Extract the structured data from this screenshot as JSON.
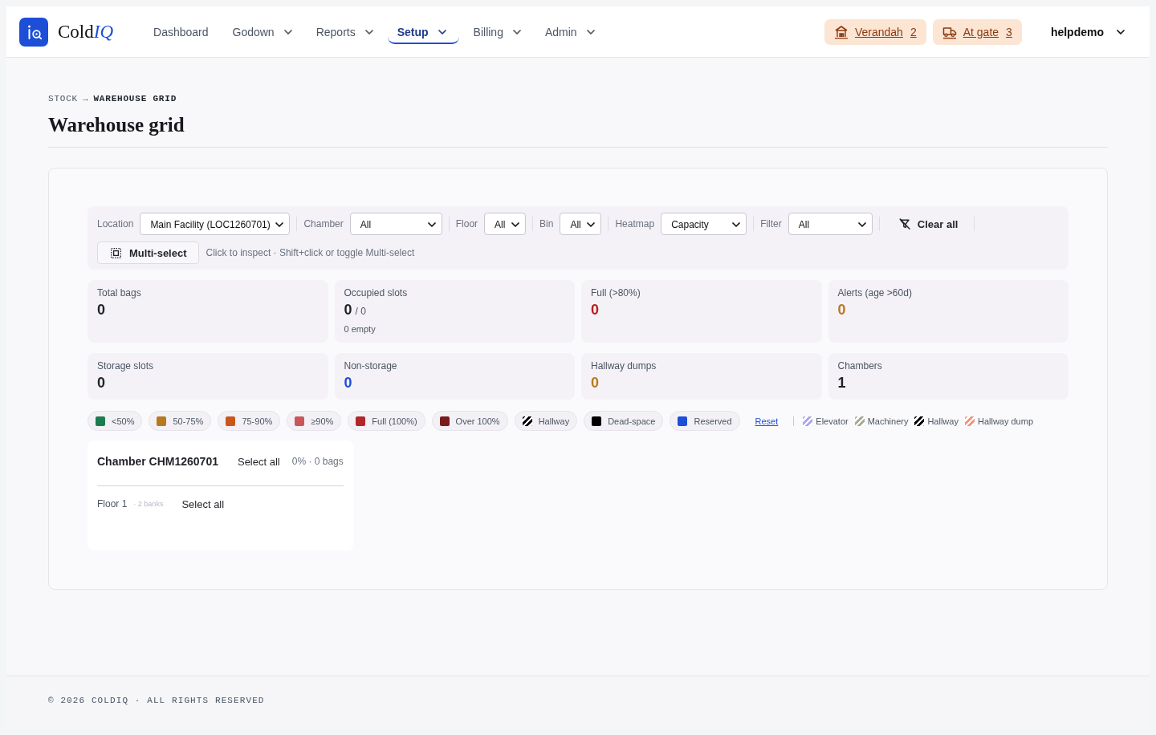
{
  "header": {
    "brand": {
      "main": "Cold",
      "accent": "IQ"
    },
    "nav": [
      {
        "label": "Dashboard",
        "selected": false,
        "dropdown": false
      },
      {
        "label": "Godown",
        "selected": false,
        "dropdown": true
      },
      {
        "label": "Reports",
        "selected": false,
        "dropdown": true
      },
      {
        "label": "Setup",
        "selected": true,
        "dropdown": true
      },
      {
        "label": "Billing",
        "selected": false,
        "dropdown": true
      },
      {
        "label": "Admin",
        "selected": false,
        "dropdown": true
      }
    ],
    "queues": [
      {
        "label": "Verandah",
        "count": "2",
        "kind": "shelter"
      },
      {
        "label": "At gate",
        "count": "3",
        "kind": "truck"
      }
    ],
    "user": "helpdemo"
  },
  "breadcrumb": {
    "items": [
      {
        "label": "STOCK",
        "current": false
      },
      {
        "label": "WAREHOUSE GRID",
        "current": true
      }
    ],
    "separator": "→"
  },
  "title": "Warehouse grid",
  "filters": {
    "fields": [
      {
        "label": "Location",
        "value": "Main Facility (LOC1260701)"
      },
      {
        "label": "Chamber",
        "value": "All"
      },
      {
        "label": "Floor",
        "value": "All"
      },
      {
        "label": "Bin",
        "value": "All"
      },
      {
        "label": "Heatmap",
        "value": "Capacity"
      },
      {
        "label": "Filter",
        "value": "All"
      }
    ],
    "clear": "Clear all",
    "multi_select": "Multi-select",
    "hint": "Click to inspect · Shift+click or toggle Multi-select"
  },
  "stats": [
    {
      "label": "Total bags",
      "value": "0",
      "color": "#1f2328"
    },
    {
      "label": "Occupied slots",
      "value": "0",
      "total": "/ 0",
      "note": "0 empty",
      "color": "#1f2328"
    },
    {
      "label": "Full (>80%)",
      "value": "0",
      "color": "#b91c1c"
    },
    {
      "label": "Alerts (age >60d)",
      "value": "0",
      "color": "#b7791f"
    },
    {
      "label": "Storage slots",
      "value": "0",
      "color": "#1f2328"
    },
    {
      "label": "Non-storage",
      "value": "0",
      "color": "#1d4ed8"
    },
    {
      "label": "Hallway dumps",
      "value": "0",
      "color": "#b7791f"
    },
    {
      "label": "Chambers",
      "value": "1",
      "color": "#1f2328"
    }
  ],
  "legend": {
    "items": [
      {
        "label": "<50%",
        "color": "#1e7b4f",
        "kind": "solid"
      },
      {
        "label": "50-75%",
        "color": "#b7791f",
        "kind": "solid"
      },
      {
        "label": "75-90%",
        "color": "#c8571c",
        "kind": "solid"
      },
      {
        "label": "≥90%",
        "color": "#c95757",
        "kind": "solid"
      },
      {
        "label": "Full (100%)",
        "color": "#b1262b",
        "kind": "solid"
      },
      {
        "label": "Over 100%",
        "color": "#7b1a1a",
        "kind": "solid"
      },
      {
        "label": "Hallway",
        "color": "#000000",
        "kind": "striped"
      },
      {
        "label": "Dead-space",
        "color": "#000000",
        "kind": "solid"
      },
      {
        "label": "Reserved",
        "color": "#1d4ed8",
        "kind": "solid"
      }
    ],
    "reset": "Reset",
    "patterns": [
      {
        "label": "Elevator",
        "color": "#aba6ee"
      },
      {
        "label": "Machinery",
        "color": "#a9a998"
      },
      {
        "label": "Hallway",
        "color": "#000000"
      },
      {
        "label": "Hallway dump",
        "color": "#f0967a"
      }
    ]
  },
  "chamber": {
    "title": "Chamber CHM1260701",
    "select_all": "Select all",
    "summary": "0% · 0 bags",
    "floors": [
      {
        "label": "Floor 1",
        "banks": "· 2 banks",
        "select_all": "Select all"
      }
    ]
  },
  "footer": "© 2026 COLDIQ · ALL RIGHTS RESERVED"
}
